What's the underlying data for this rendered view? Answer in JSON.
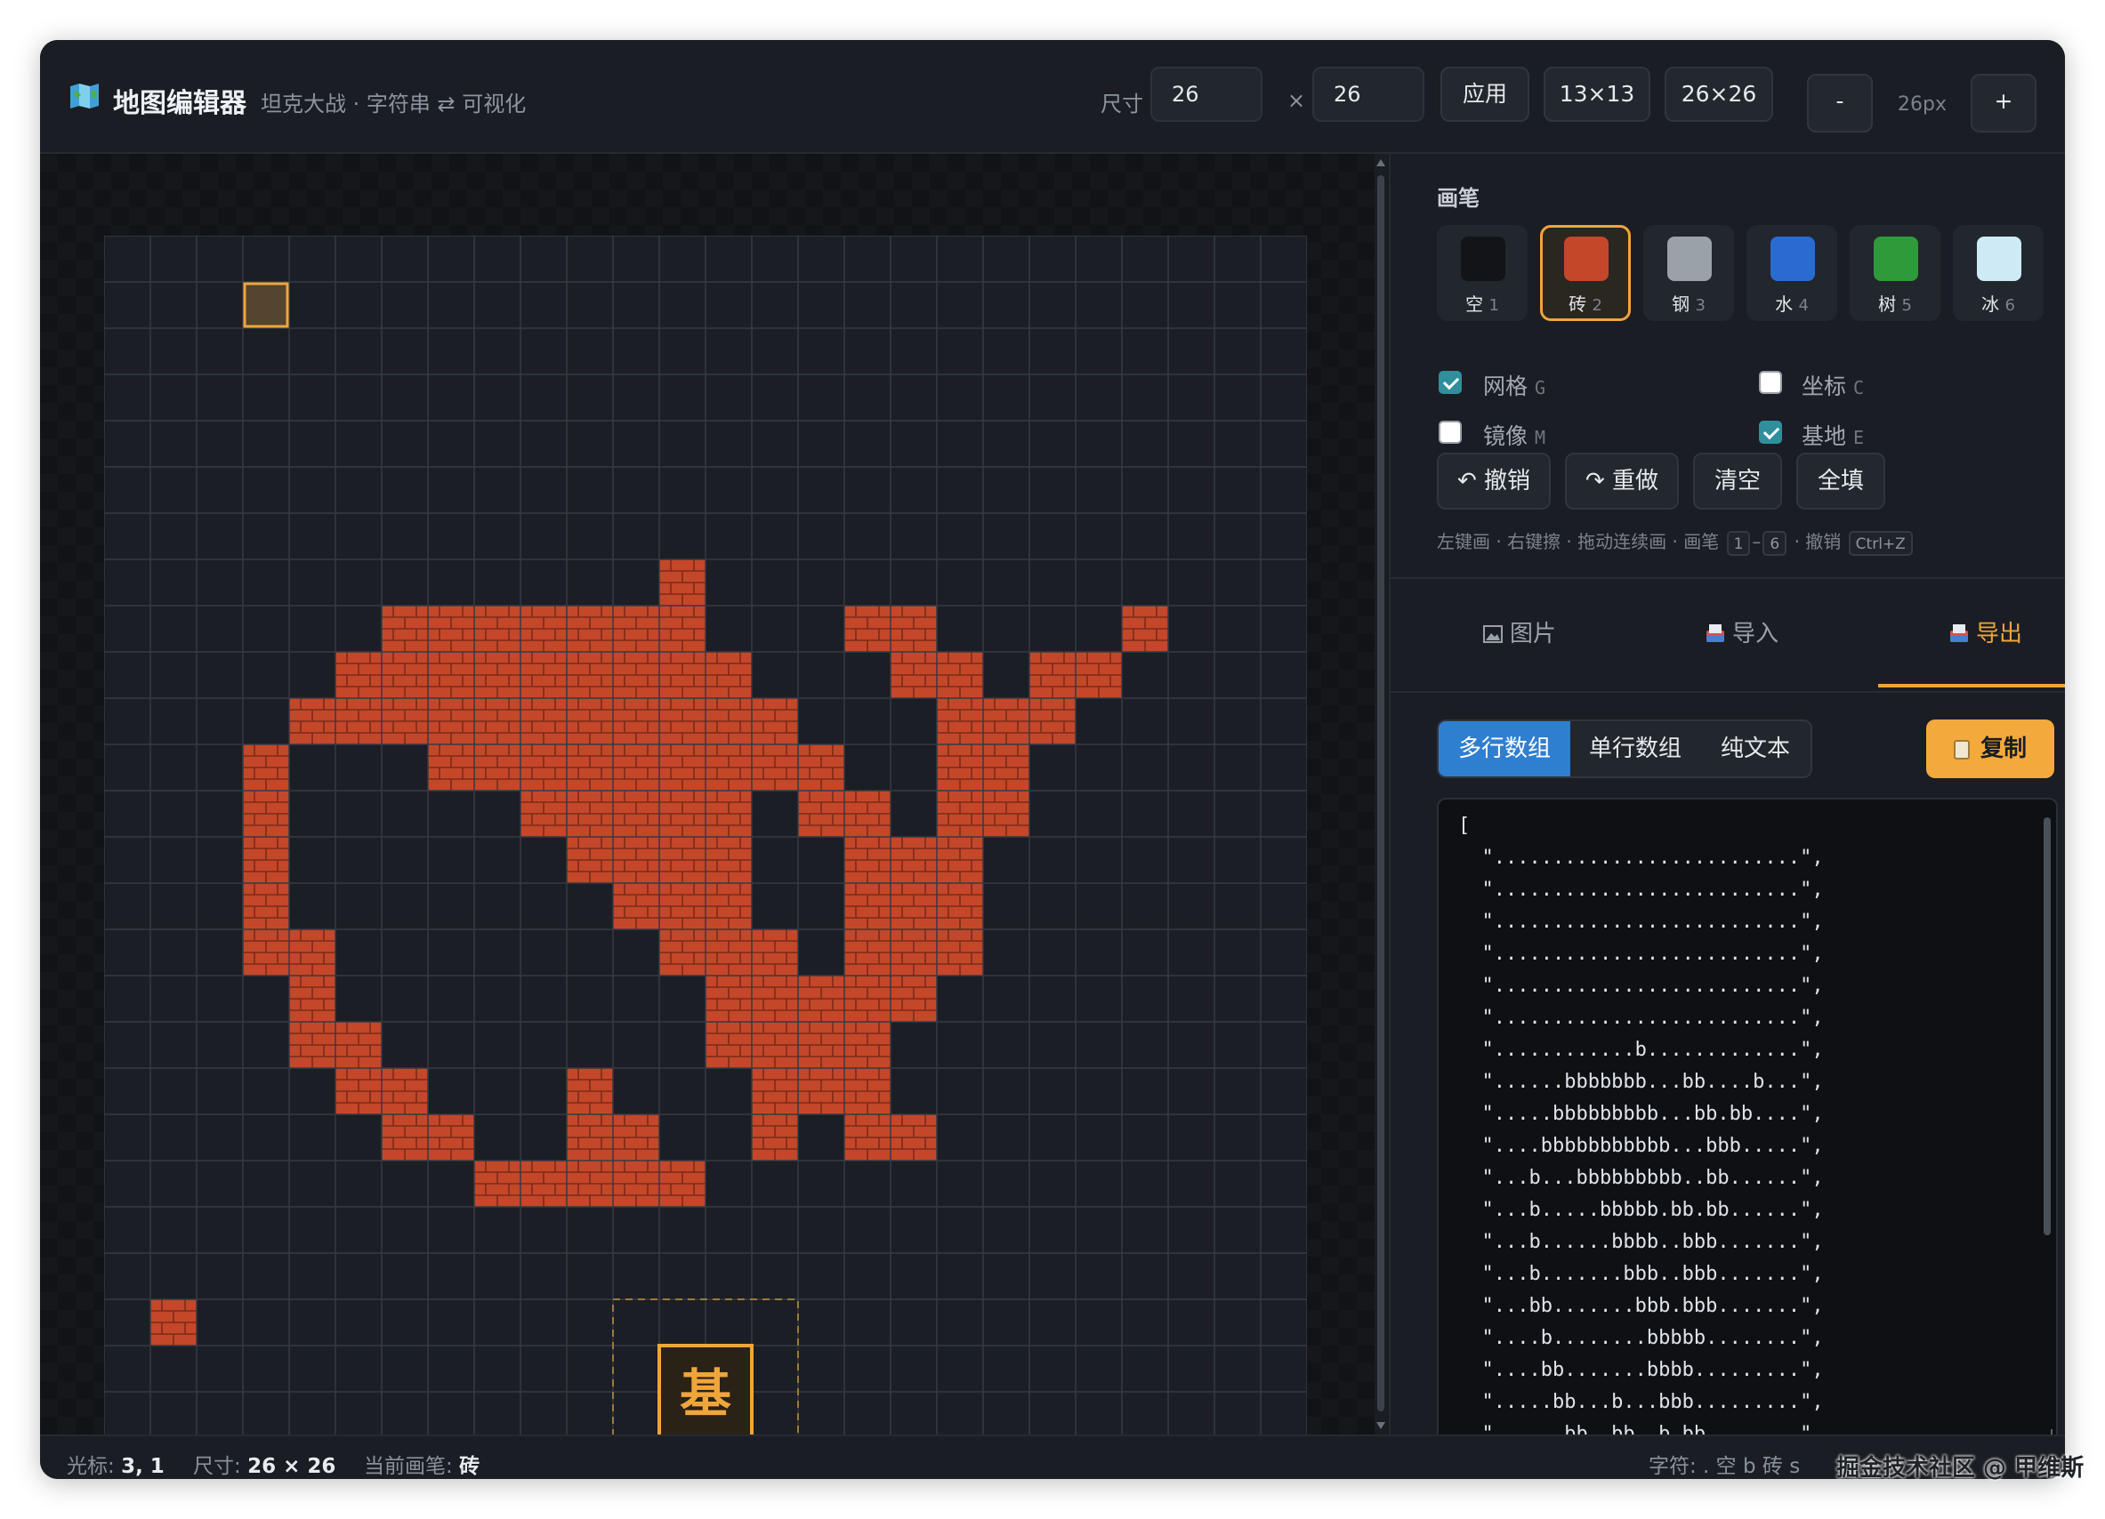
{
  "app": {
    "title": "地图编辑器",
    "subtitle": "坦克大战 · 字符串 ⇄ 可视化"
  },
  "toolbar": {
    "size_label": "尺寸",
    "width_value": "26",
    "times": "×",
    "height_value": "26",
    "apply_label": "应用",
    "preset_13": "13×13",
    "preset_26": "26×26",
    "zoom_out_label": "-",
    "zoom_value": "26px",
    "zoom_in_label": "+"
  },
  "brush": {
    "section_title": "画笔",
    "items": [
      {
        "name": "空",
        "key": "1",
        "color": "#121417"
      },
      {
        "name": "砖",
        "key": "2",
        "color": "#c4472a",
        "selected": true
      },
      {
        "name": "钢",
        "key": "3",
        "color": "#9aa1a9"
      },
      {
        "name": "水",
        "key": "4",
        "color": "#2a6bd1"
      },
      {
        "name": "树",
        "key": "5",
        "color": "#2f9a3a"
      },
      {
        "name": "冰",
        "key": "6",
        "color": "#cdeaf5"
      }
    ]
  },
  "options": {
    "grid": {
      "label": "网格",
      "key": "G",
      "checked": true
    },
    "coords": {
      "label": "坐标",
      "key": "C",
      "checked": false
    },
    "mirror": {
      "label": "镜像",
      "key": "M",
      "checked": false
    },
    "base": {
      "label": "基地",
      "key": "E",
      "checked": true
    }
  },
  "actions": {
    "undo": "↶ 撤销",
    "redo": "↷ 重做",
    "clear": "清空",
    "fill": "全填"
  },
  "hint": {
    "text1": "左键画 · 右键擦 · 拖动连续画 · 画笔",
    "key_from": "1",
    "dash": "–",
    "key_to": "6",
    "text2": "· 撤销",
    "undo_key": "Ctrl+Z"
  },
  "tabs": [
    {
      "label": "图片",
      "active": false
    },
    {
      "label": "导入",
      "active": false
    },
    {
      "label": "导出",
      "active": true
    }
  ],
  "export": {
    "formats": [
      "多行数组",
      "单行数组",
      "纯文本"
    ],
    "active_format": 0,
    "copy_label": "复制",
    "lines": [
      "[",
      "  \"..........................\",",
      "  \"..........................\",",
      "  \"..........................\",",
      "  \"..........................\",",
      "  \"..........................\",",
      "  \"..........................\",",
      "  \"............b.............\",",
      "  \"......bbbbbbb...bb....b...\",",
      "  \".....bbbbbbbbb...bb.bb....\",",
      "  \"....bbbbbbbbbbb...bbb.....\",",
      "  \"...b...bbbbbbbbb..bb......\",",
      "  \"...b.....bbbbb.bb.bb......\",",
      "  \"...b......bbbb..bbb.......\",",
      "  \"...b.......bbb..bbb.......\",",
      "  \"...bb.......bbb.bbb.......\",",
      "  \"....b........bbbbb........\",",
      "  \"....bb.......bbbb.........\",",
      "  \".....bb...b...bbb.........\",",
      "  \"......bb..bb..b.bb........\","
    ]
  },
  "map": {
    "cols": 26,
    "rows": 26,
    "cursor": [
      3,
      1
    ],
    "base_label": "基",
    "grid": [
      "..........................",
      "..........................",
      "..........................",
      "..........................",
      "..........................",
      "..........................",
      "..........................",
      "............b.............",
      "......bbbbbbb...bb....b...",
      ".....bbbbbbbbb...bb.bb....",
      "....bbbbbbbbbbb...bbb.....",
      "...b...bbbbbbbbb..bb......",
      "...b.....bbbbb.bb.bb......",
      "...b......bbbb..bbb.......",
      "...b.......bbb..bbb.......",
      "...bb.......bbb.bbb.......",
      "....b........bbbbb........",
      "....bb.......bbbb.........",
      ".....bb...b...bbb.........",
      "......bb..bb..b.bb........",
      "........bbbbb.............",
      "..........................",
      "..........................",
      ".b........................",
      "..........................",
      ".........................."
    ]
  },
  "status": {
    "cursor_label": "光标:",
    "cursor_value": "3, 1",
    "size_label": "尺寸:",
    "size_value": "26 × 26",
    "brush_label": "当前画笔:",
    "brush_value": "砖",
    "legend_label": "字符: . 空   b 砖   s"
  },
  "watermark": "掘金技术社区 @ 甲维斯",
  "colors": {
    "accent": "#f0a53a",
    "brick": "#c4472a",
    "primary": "#2f7fd1"
  }
}
